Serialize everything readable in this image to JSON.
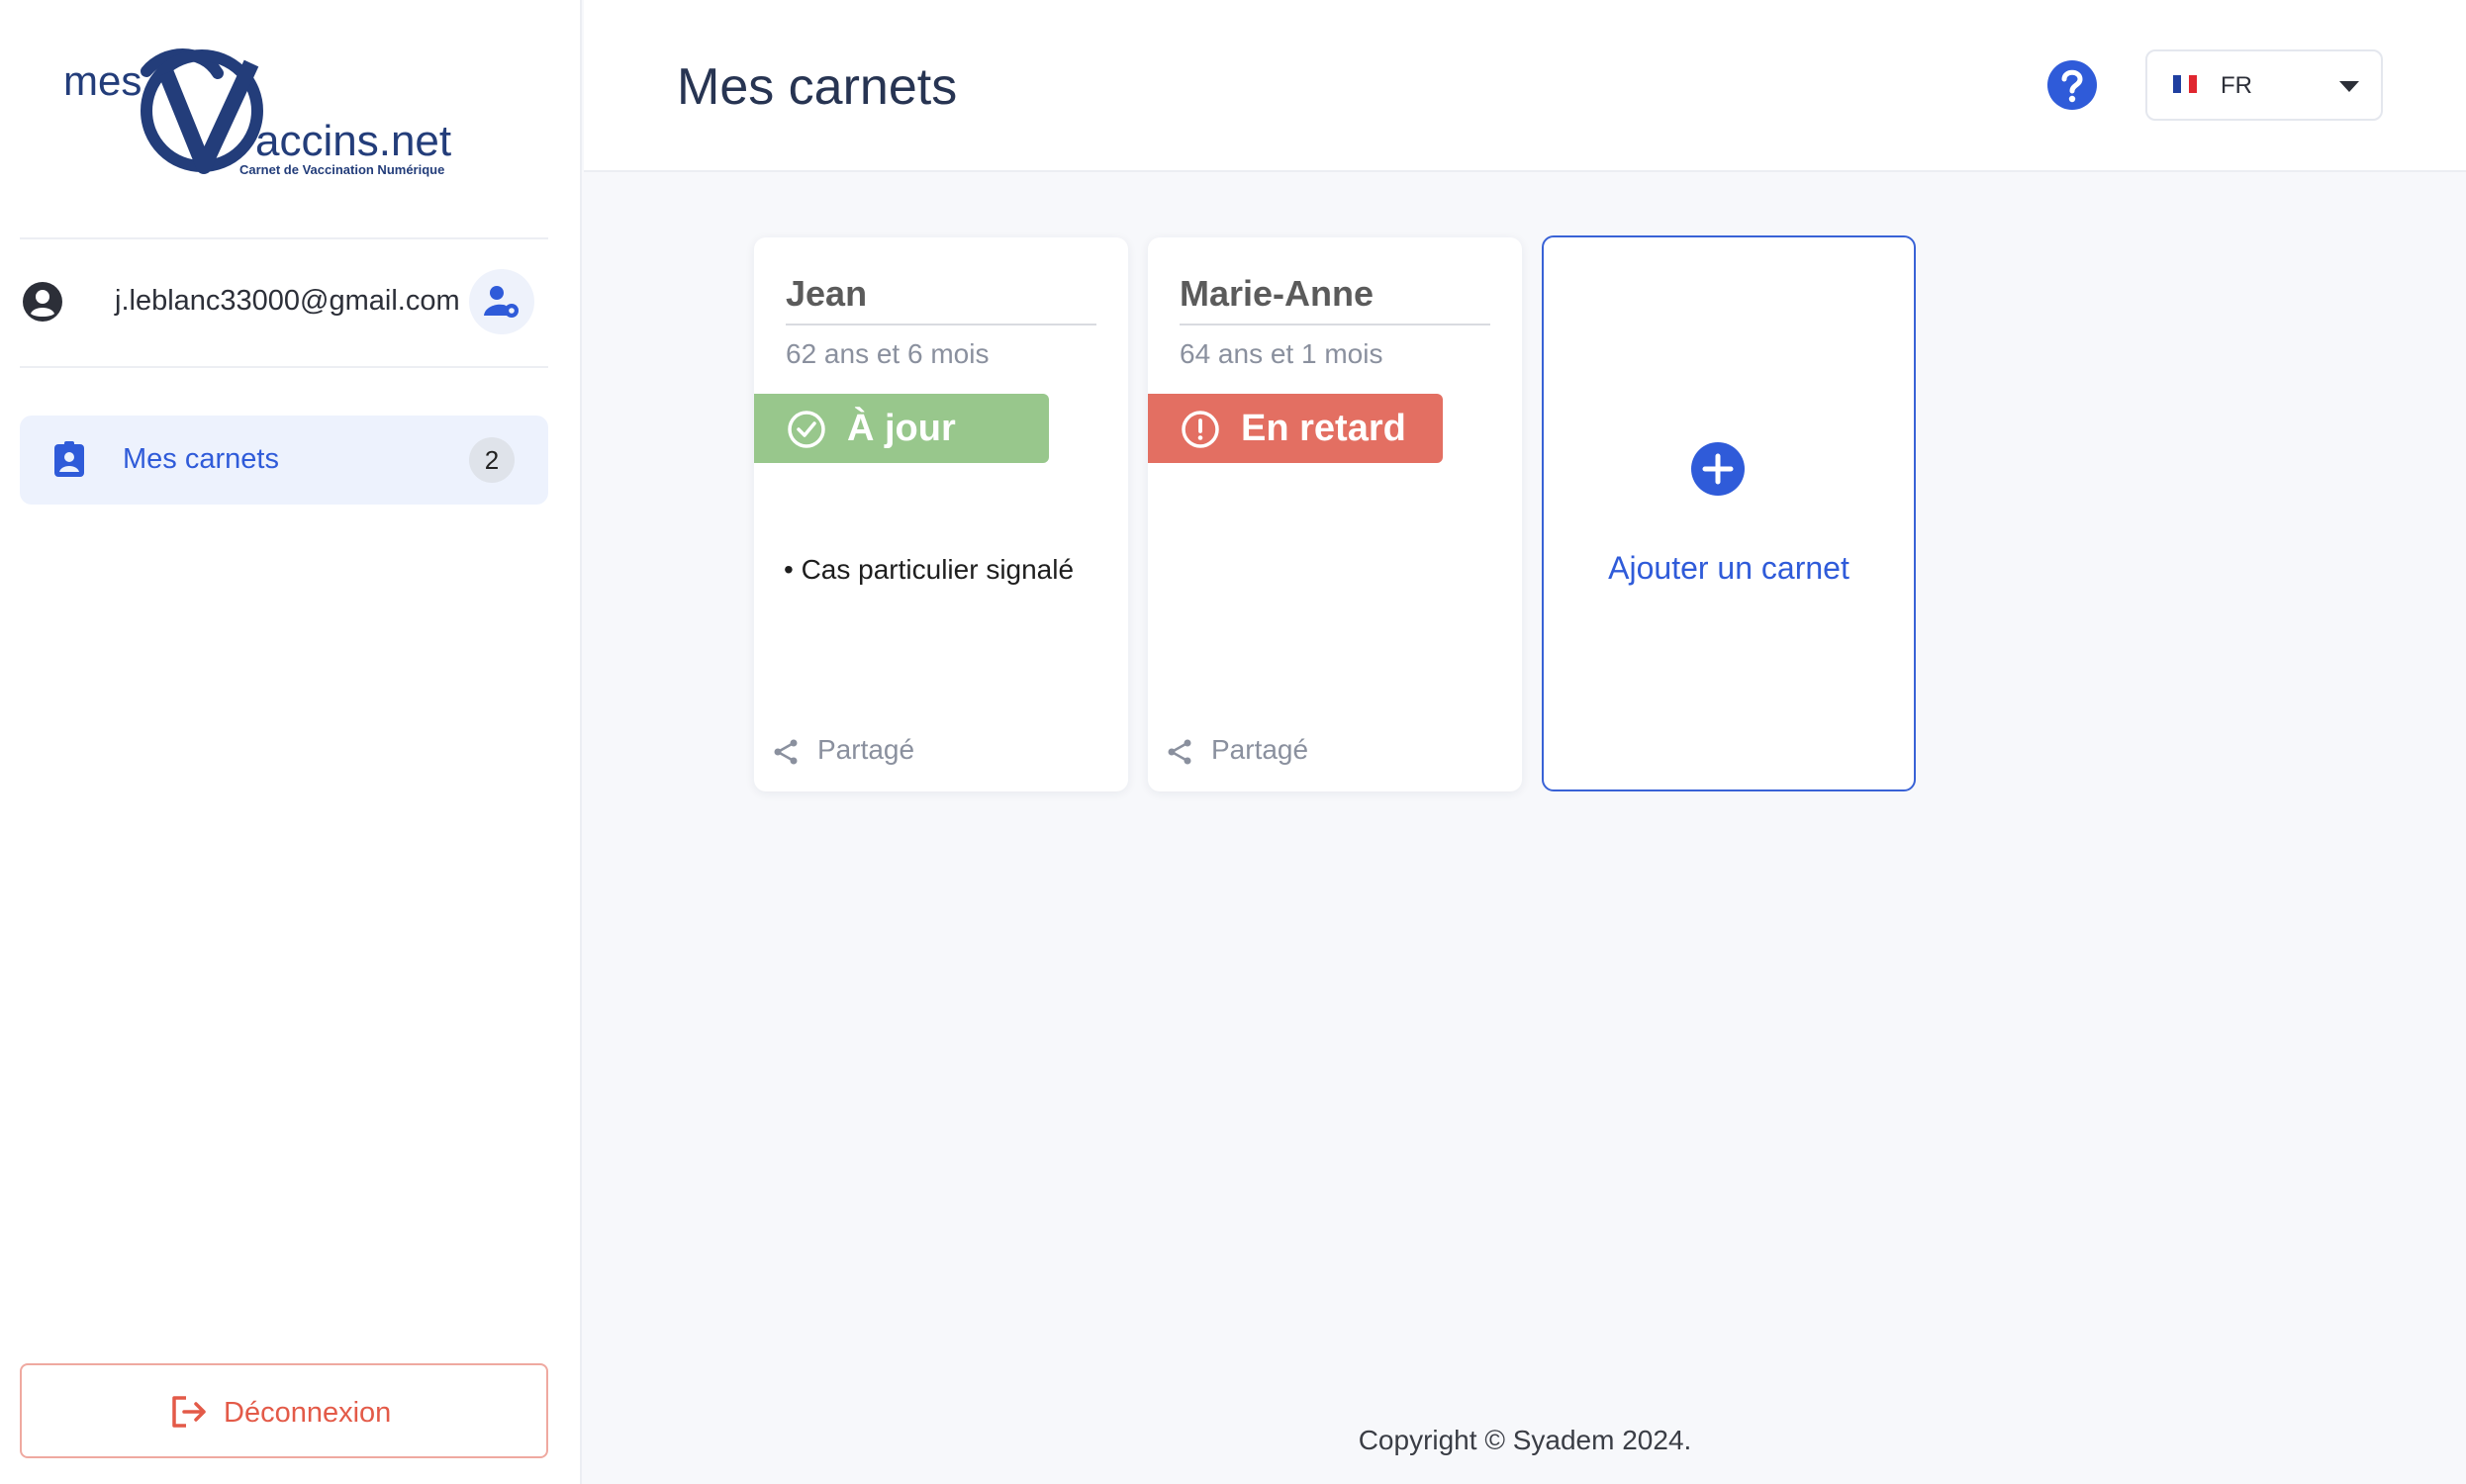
{
  "brand": {
    "logo_prefix": "mes",
    "logo_suffix": "accins.net",
    "logo_tagline": "Carnet de Vaccination Numérique"
  },
  "sidebar": {
    "user_email": "j.leblanc33000@gmail.com",
    "nav": [
      {
        "label": "Mes carnets",
        "count": "2"
      }
    ],
    "logout_label": "Déconnexion"
  },
  "header": {
    "title": "Mes carnets",
    "language": "FR"
  },
  "cards": [
    {
      "name": "Jean",
      "age": "62 ans et 6 mois",
      "status": "À jour",
      "status_color": "#98c78c",
      "note": "• Cas particulier signalé",
      "share_label": "Partagé"
    },
    {
      "name": "Marie-Anne",
      "age": "64 ans et 1 mois",
      "status": "En retard",
      "status_color": "#e36f62",
      "note": "",
      "share_label": "Partagé"
    }
  ],
  "add_card": {
    "label": "Ajouter un carnet"
  },
  "footer": {
    "copyright": "Copyright © Syadem 2024."
  },
  "colors": {
    "accent": "#2f5bd9",
    "logout": "#e35a48",
    "navy": "#233d7a"
  }
}
